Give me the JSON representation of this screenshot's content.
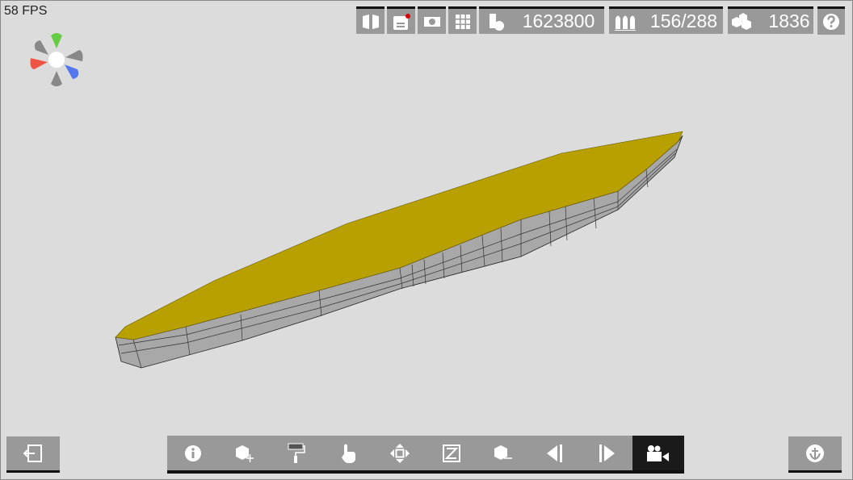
{
  "fps": "58 FPS",
  "stats": {
    "triangles": "1623800",
    "objects": "156/288",
    "parts": "1836"
  },
  "colors": {
    "deck": "#b8a000",
    "hull": "#a8a8a8",
    "button": "#999999",
    "active": "#1a1a1a"
  },
  "top_icons": [
    "book-icon",
    "save-icon",
    "camera-icon",
    "grid-icon",
    "triangles-icon",
    "objects-icon",
    "parts-icon",
    "help-icon"
  ],
  "bottom_icons": [
    "info-icon",
    "add-part-icon",
    "paint-roller-icon",
    "hand-pointer-icon",
    "move-icon",
    "resize-icon",
    "remove-part-icon",
    "previous-icon",
    "next-icon",
    "video-camera-icon"
  ]
}
